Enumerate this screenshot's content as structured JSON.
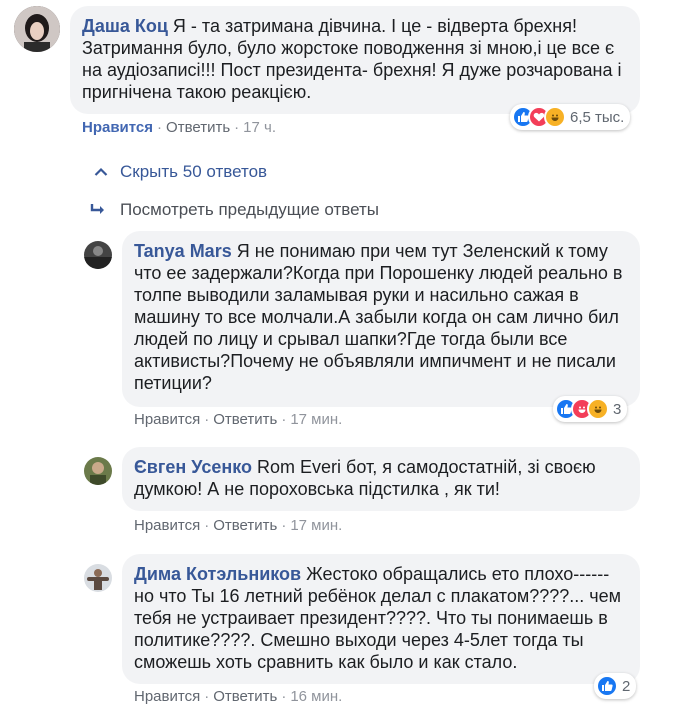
{
  "comments": [
    {
      "author": "Даша Коц",
      "text": "Я - та затримана дівчина. І це - відверта брехня! Затримання було, було жорстоке поводження зі мною,і це все є на аудіозаписі!!! Пост президента- брехня! Я дуже розчарована і пригнічена такою реакцією.",
      "like": "Нравится",
      "reply": "Ответить",
      "time": "17 ч.",
      "reactions_count": "6,5 тыс.",
      "reactions": [
        "like-icon",
        "love-icon",
        "haha-icon"
      ]
    },
    {
      "author": "Tanya Mars",
      "text": "Я не понимаю при чем тут Зеленский к тому что ее задержали?Когда при Порошенку людей реально в толпе выводили заламывая руки и насильно сажая в машину то все молчали.А забыли когда он сам лично бил людей по лицу и срывал шапки?Где тогда были все активисты?Почему не объявляли импичмент и не писали петиции?",
      "like": "Нравится",
      "reply": "Ответить",
      "time": "17 мин.",
      "reactions_count": "3",
      "reactions": [
        "like-icon",
        "haha-icon",
        "haha-icon"
      ]
    },
    {
      "author": "Євген Усенко",
      "text": "Rom Everi бот, я самодостатній, зі своєю думкою! А не пороховська підстилка , як ти!",
      "like": "Нравится",
      "reply": "Ответить",
      "time": "17 мин."
    },
    {
      "author": "Дима Котэльников",
      "text": "Жестоко обращались ето плохо------ но что Ты 16 летний ребёнок делал с плакатом????... чем тебя не устраивает президент????. Что ты понимаешь в политике????. Смешно выходи через 4-5лет тогда ты сможешь хоть сравнить как было и как стало.",
      "like": "Нравится",
      "reply": "Ответить",
      "time": "16 мин.",
      "reactions_count": "2",
      "reactions": [
        "like-icon"
      ]
    }
  ],
  "thread": {
    "hide_label": "Скрыть 50 ответов",
    "prev_label": "Посмотреть предыдущие ответы"
  },
  "colors": {
    "author": "#385898",
    "bubble": "#f2f3f5",
    "like_active": "#4267b2",
    "meta": "#90949c"
  }
}
